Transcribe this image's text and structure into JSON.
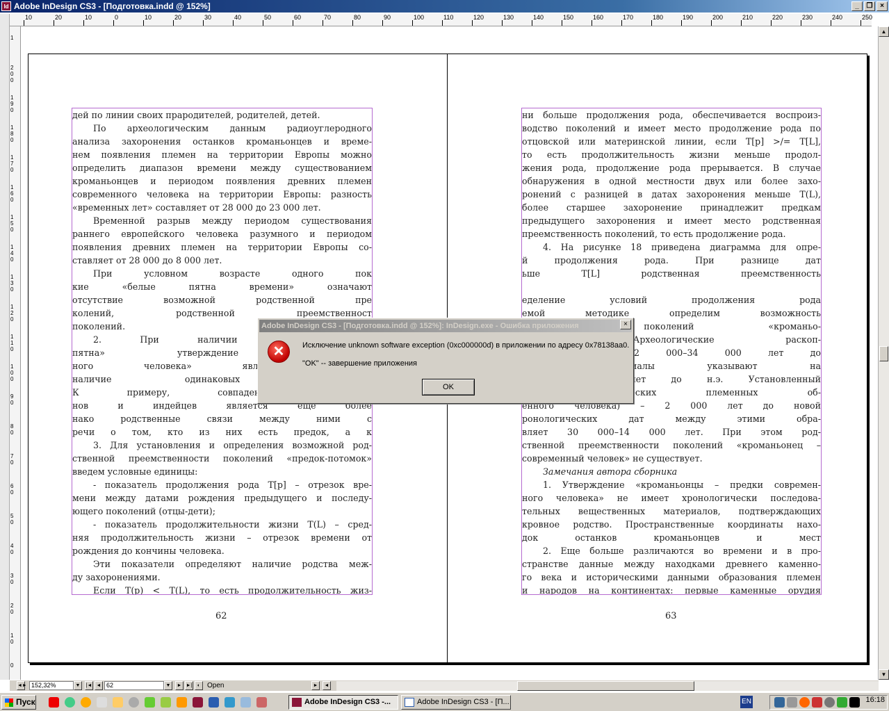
{
  "window": {
    "title": "Adobe InDesign CS3 - [Подготовка.indd @ 152%]",
    "app_icon": "Id"
  },
  "ruler": {
    "top_labels": [
      "10",
      "20",
      "10",
      "0",
      "10",
      "20",
      "30",
      "40",
      "50",
      "60",
      "70",
      "80",
      "90",
      "100",
      "110",
      "120",
      "130",
      "140",
      "150",
      "160",
      "170",
      "180",
      "190",
      "200",
      "210",
      "220",
      "230",
      "240",
      "250"
    ],
    "left_labels": [
      "1",
      "2 0 0",
      "1 9 0",
      "1 8 0",
      "1 7 0",
      "1 6 0",
      "1 5 0",
      "1 4 0",
      "1 3 0",
      "1 2 0",
      "1 1 0",
      "1 0 0",
      "9 0",
      "8 0",
      "7 0",
      "6 0",
      "5 0",
      "4 0",
      "3 0",
      "2 0",
      "1 0",
      "0"
    ]
  },
  "left_page": {
    "lines": [
      "дей по линии своих прародителей, родителей, детей.",
      "По археологическим данным радиоуглеродного",
      "анализа захоронения останков кроманьонцев и време-",
      "нем появления племен на территории Европы можно",
      "определить диапазон времени между существованием",
      "кроманьонцев и периодом появления древних племен",
      "современного человека на территории Европы: разность",
      "«временных лет» составляет от 28 000 до 23 000 лет.",
      "Временной разрыв между периодом существования",
      "раннего европейского человека разумного и периодом",
      "появления древних племен на территории Европы со-",
      "ставляет от 28 000 до 8 000 лет.",
      "При условном возрасте одного пок",
      "кие «белые пятна времени» означают",
      "отсутствие возможной родственной пре",
      "колений, родственной преемственност",
      "поколений.",
      "2. При наличии такого хроно",
      "пятна» утверждение «кроманьонц",
      "ного человека» является недоказ",
      "наличие одинаковых генетически",
      "К примеру, совпадение генетическ",
      "нов и индейцев является еще более",
      "нако родственные связи между ними с",
      "речи о том, кто из них есть предок, а к",
      "3. Для установления и определения возможной род-",
      "ственной преемственности поколений «предок-потомок»",
      "введем условные единицы:",
      "- показатель продолжения рода T[p] – отрезок вре-",
      "мени между датами рождения предыдущего и последу-",
      "ющего поколений (отцы-дети);",
      "- показатель продолжительности жизни T(L) – сред-",
      "няя продолжительность жизни – отрезок времени от",
      "рождения до кончины человека.",
      "Эти показатели определяют наличие родства меж-",
      "ду захоронениями.",
      "Если T(p) < T(L), то есть продолжительность жиз-"
    ],
    "page_number": "62"
  },
  "right_page": {
    "lines": [
      "ни больше продолжения рода, обеспечивается воспроиз-",
      "водство поколений и имеет место продолжение рода по",
      "отцовской или материнской линии, если T[p] >/= T[L],",
      "то есть продолжительность жизни меньше продол-",
      "жения рода, продолжение рода прерывается. В случае",
      "обнаружения в одной местности двух или более захо-",
      "ронений с разницей в датах захоронения меньше T(L),",
      "более старшее захоронение принадлежит предкам",
      "предыдущего захоронения и имеет место родственная",
      "преемственность поколений, то есть продолжение рода.",
      "4. На рисунке 18 приведена диаграмма для опре-",
      "й продолжения рода. При разнице дат",
      "ьше T[L] родственная преемственность",
      "",
      "еделение условий продолжения рода",
      "емой методике определим возможность",
      "твенности поколений «кроманьо-",
      "еловек». Археологические раскоп-",
      "еют возраст 32 000–34 000 лет до",
      "енные материалы указывают на",
      "в 16 000 лет до н.э. Установленный",
      "раст исторических племенных об-",
      "енного человека) – 2 000 лет до новой",
      "ронологических дат между этими обра-",
      "вляет 30 000–14 000 лет. При этом род-",
      "ственной преемственности поколений «кроманьонец –",
      "современный человек» не существует.",
      "Замечания автора сборника",
      "1. Утверждение «кроманьонцы – предки современ-",
      "ного человека» не имеет хронологически последова-",
      "тельных вещественных материалов, подтверждающих",
      "кровное родство. Пространственные координаты нахо-",
      "док останков кроманьонцев и мест",
      "2. Еще больше различаются во времени и в про-",
      "странстве данные между находками древнего каменно-",
      "го века и историческими данными образования племен",
      "и народов на континентах: первые каменные орудия"
    ],
    "page_number": "63"
  },
  "dialog": {
    "title": "Adobe InDesign CS3 - [Подготовка.indd @ 152%]: InDesign.exe - Ошибка приложения",
    "close_glyph": "×",
    "icon": "error-icon",
    "message": "Исключение unknown software exception (0xc000000d) в приложении по адресу 0x78138aa0.",
    "instruction": "\"OK\" -- завершение приложения",
    "ok_label": "OK"
  },
  "statusbar": {
    "zoom": "152,32%",
    "page": "62",
    "status": "Open"
  },
  "taskbar": {
    "start_label": "Пуск",
    "tasks": [
      {
        "label": "Adobe InDesign CS3 -...",
        "active": true
      },
      {
        "label": "Adobe InDesign CS3 - [П...",
        "active": false
      }
    ],
    "lang": "EN",
    "clock": "16:18"
  },
  "colors": {
    "title_active": "#0a246a",
    "frame_border": "#b56ad0",
    "error_red": "#c00000"
  }
}
